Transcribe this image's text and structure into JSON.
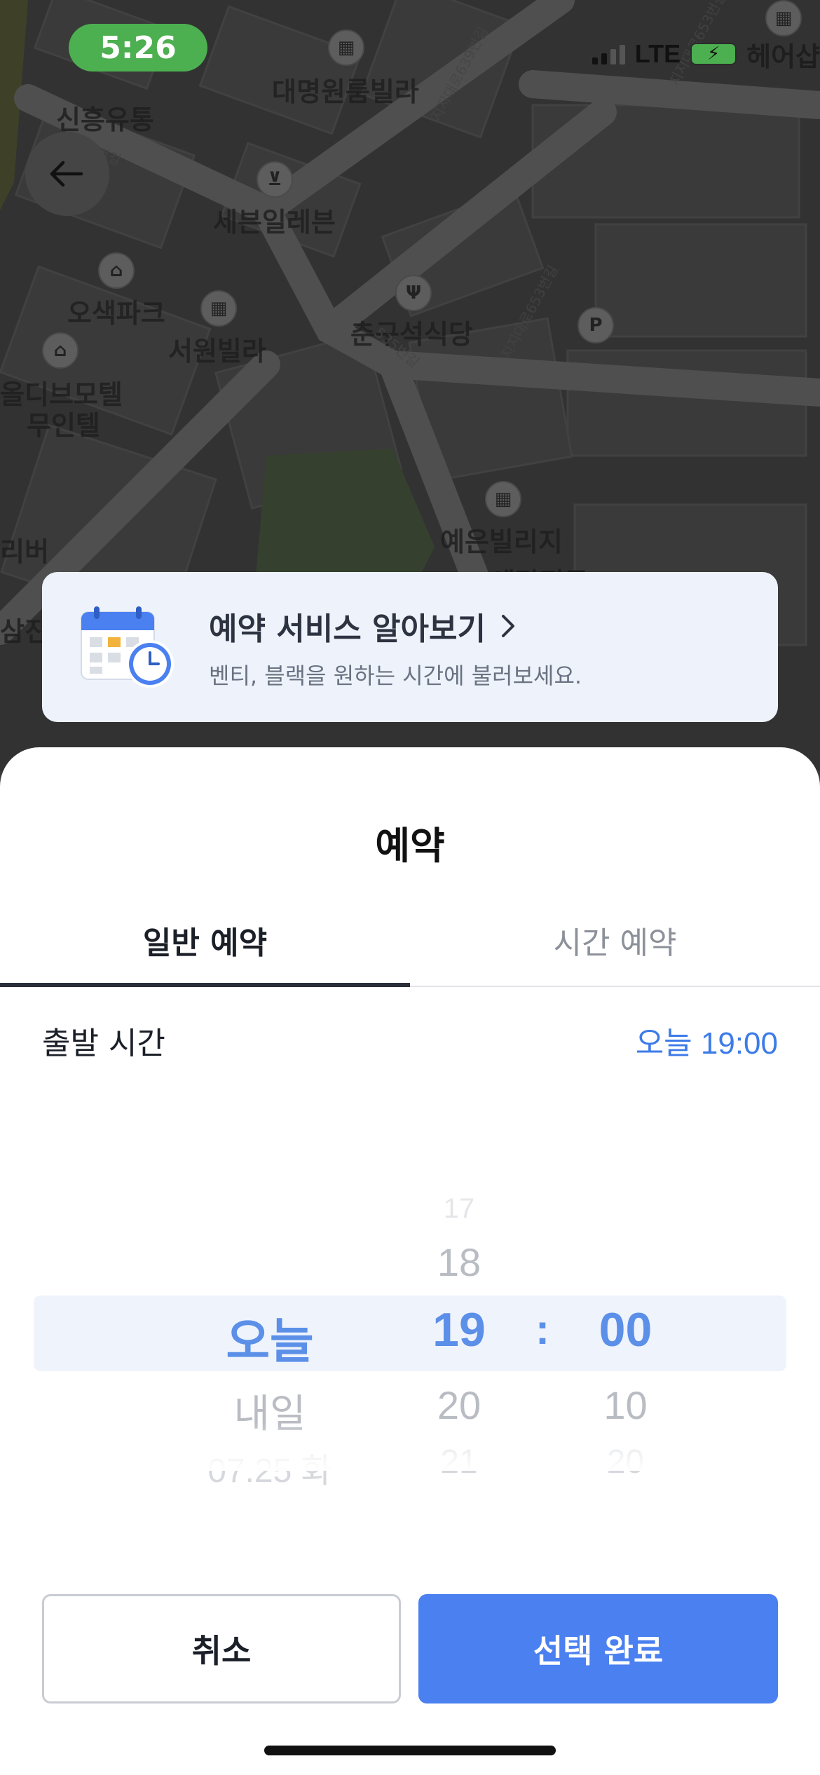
{
  "status_bar": {
    "time": "5:26",
    "network": "LTE",
    "carrier_overflow": "헤어샵"
  },
  "map": {
    "places": [
      "신흥유통",
      "대명원룸빌라",
      "세븐일레븐",
      "오색파크",
      "서원빌라",
      "춘구석식당",
      "올디브모텔",
      "무인텔",
      "예은빌리지",
      "리버",
      "삼진",
      "세탁전문"
    ],
    "roads": [
      "지지대로653번길",
      "지지대로639번길",
      "지지대로653번길",
      "535번길",
      "535번길"
    ]
  },
  "promo": {
    "title": "예약 서비스 알아보기",
    "subtitle": "벤티, 블랙을 원하는 시간에 불러보세요."
  },
  "sheet": {
    "title": "예약",
    "tabs": [
      {
        "label": "일반 예약",
        "active": true
      },
      {
        "label": "시간 예약",
        "active": false
      }
    ],
    "departure_label": "출발 시간",
    "departure_value": "오늘 19:00",
    "picker": {
      "day": {
        "selected": "오늘",
        "after": [
          "내일",
          "07.25 화"
        ]
      },
      "hour": {
        "before": [
          "17",
          "18"
        ],
        "selected": "19",
        "after": [
          "20",
          "21"
        ]
      },
      "separator": ":",
      "minute": {
        "selected": "00",
        "after": [
          "10",
          "20"
        ]
      }
    },
    "cancel_label": "취소",
    "confirm_label": "선택 완료"
  },
  "colors": {
    "accent": "#4a80f0",
    "accent_text": "#3d7be8",
    "status_pill": "#4caf50"
  }
}
